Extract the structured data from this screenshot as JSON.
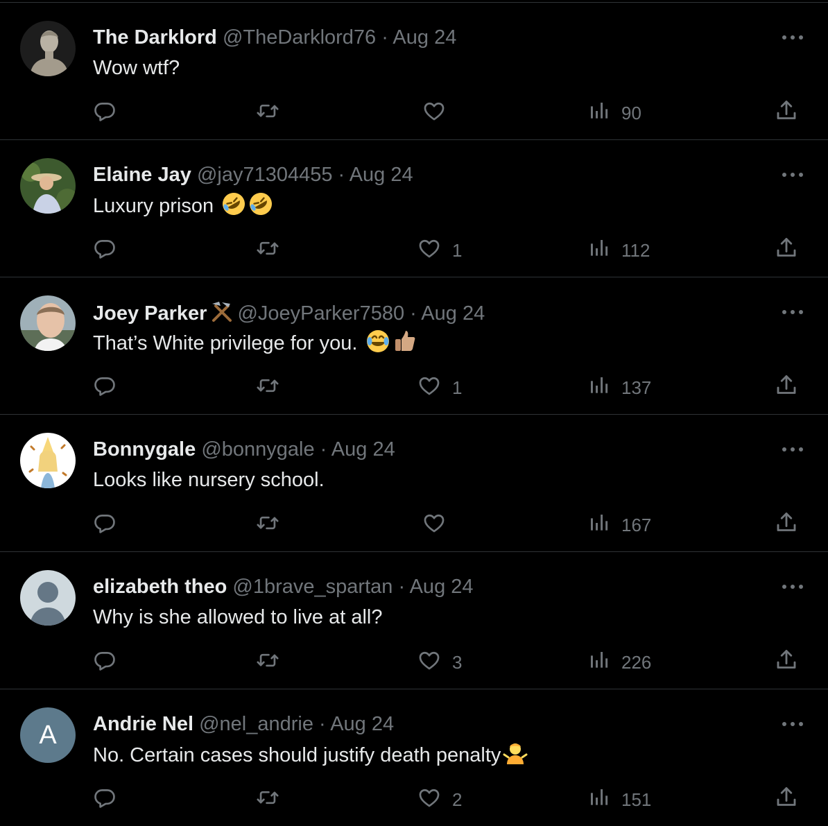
{
  "tweets": [
    {
      "name": "The Darklord",
      "handle": "@TheDarklord76",
      "sep": "·",
      "date": "Aug 24",
      "text": "Wow wtf?",
      "likes": "",
      "views": "90",
      "avatar_icon": "statue-bust-avatar",
      "emoji": []
    },
    {
      "name": "Elaine Jay",
      "handle": "@jay71304455",
      "sep": "·",
      "date": "Aug 24",
      "text": "Luxury prison ",
      "likes": "1",
      "views": "112",
      "avatar_icon": "woman-sunhat-photo-avatar",
      "emoji": [
        "rofl-emoji",
        "rofl-emoji"
      ]
    },
    {
      "name": "Joey Parker",
      "handle": "@JoeyParker7580",
      "sep": "·",
      "date": "Aug 24",
      "text": "That’s White privilege for you. ",
      "likes": "1",
      "views": "137",
      "avatar_icon": "man-photo-avatar",
      "emoji": [
        "tears-of-joy-emoji",
        "thumbs-up-emoji"
      ],
      "badge": "hammer-pick-icon"
    },
    {
      "name": "Bonnygale",
      "handle": "@bonnygale",
      "sep": "·",
      "date": "Aug 24",
      "text": "Looks like nursery school.",
      "likes": "",
      "views": "167",
      "avatar_icon": "cartoon-girl-avatar",
      "emoji": []
    },
    {
      "name": "elizabeth theo",
      "handle": "@1brave_spartan",
      "sep": "·",
      "date": "Aug 24",
      "text": "Why is she allowed to live at all?",
      "likes": "3",
      "views": "226",
      "avatar_icon": "default-person-avatar",
      "emoji": []
    },
    {
      "name": "Andrie Nel",
      "handle": "@nel_andrie",
      "sep": "·",
      "date": "Aug 24",
      "text": "No. Certain cases should justify death penalty",
      "likes": "2",
      "views": "151",
      "avatar_icon": "initial-avatar",
      "avatar_letter": "A",
      "emoji": [
        "person-shrugging-emoji"
      ]
    }
  ],
  "colors": {
    "background": "#000000",
    "text": "#e7e9ea",
    "muted": "#71767b",
    "divider": "#2f3336"
  }
}
